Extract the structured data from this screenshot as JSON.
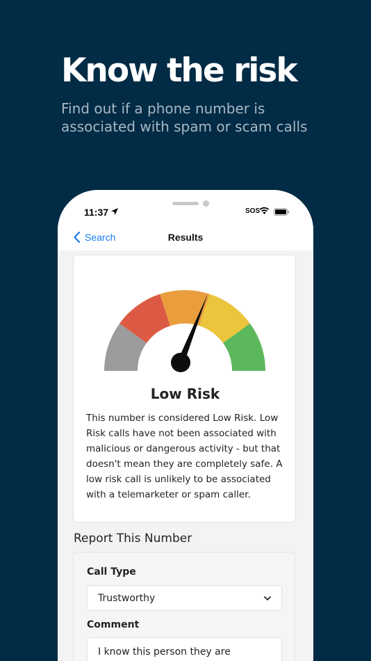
{
  "promo": {
    "headline": "Know the risk",
    "subhead": "Find out if a phone number is associated with spam or scam calls"
  },
  "status_bar": {
    "time": "11:37",
    "sos": "SOS",
    "icons": [
      "location-arrow-icon",
      "wifi-icon",
      "battery-icon"
    ]
  },
  "nav": {
    "back_label": "Search",
    "title": "Results"
  },
  "risk": {
    "level": "Low Risk",
    "description": "This number is considered Low Risk. Low Risk calls have not been associated with malicious or dangerous activity - but that doesn't mean they are completely safe. A low risk call is unlikely to be associated with a telemarketer or spam caller.",
    "gauge_segments": [
      "#9c9c9c",
      "#dc5a44",
      "#e99d3d",
      "#ebc53c",
      "#5cb85c"
    ],
    "needle_value": 0.62
  },
  "report": {
    "section_title": "Report This Number",
    "call_type_label": "Call Type",
    "call_type_value": "Trustworthy",
    "comment_label": "Comment",
    "comment_value": "I know this person they are"
  },
  "colors": {
    "background": "#022b45",
    "accent": "#1a7cf3"
  }
}
